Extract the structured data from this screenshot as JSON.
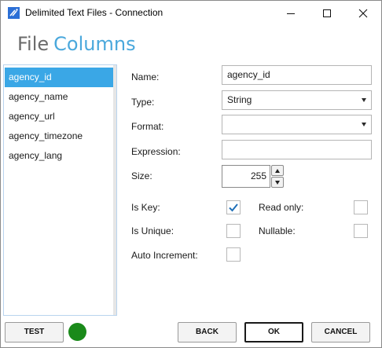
{
  "window": {
    "title": "Delimited Text Files - Connection"
  },
  "header": {
    "tab_file": "File",
    "tab_columns": "Columns"
  },
  "columns": {
    "items": [
      "agency_id",
      "agency_name",
      "agency_url",
      "agency_timezone",
      "agency_lang"
    ],
    "selected": "agency_id"
  },
  "form": {
    "name_label": "Name:",
    "name_value": "agency_id",
    "type_label": "Type:",
    "type_value": "String",
    "format_label": "Format:",
    "format_value": "",
    "expression_label": "Expression:",
    "expression_value": "",
    "size_label": "Size:",
    "size_value": "255",
    "is_key_label": "Is Key:",
    "is_key_checked": true,
    "read_only_label": "Read only:",
    "read_only_checked": false,
    "is_unique_label": "Is Unique:",
    "is_unique_checked": false,
    "nullable_label": "Nullable:",
    "nullable_checked": false,
    "auto_increment_label": "Auto Increment:",
    "auto_increment_checked": false
  },
  "buttons": {
    "test": "TEST",
    "back": "BACK",
    "ok": "OK",
    "cancel": "CANCEL"
  },
  "colors": {
    "accent": "#3aa7e6",
    "header_columns": "#4aa8dc",
    "status_ok": "#1a8a1a"
  }
}
